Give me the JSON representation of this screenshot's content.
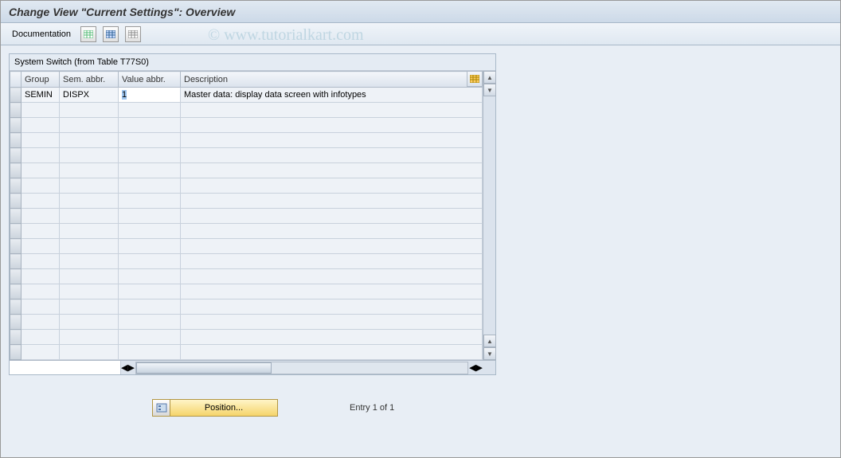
{
  "header": {
    "title": "Change View \"Current Settings\": Overview"
  },
  "toolbar": {
    "documentation_label": "Documentation"
  },
  "watermark": "© www.tutorialkart.com",
  "grid": {
    "caption": "System Switch (from Table T77S0)",
    "columns": {
      "group": "Group",
      "sem": "Sem. abbr.",
      "value": "Value abbr.",
      "desc": "Description"
    },
    "rows": [
      {
        "group": "SEMIN",
        "sem": "DISPX",
        "value": "1",
        "desc": "Master data: display data screen with infotypes"
      }
    ],
    "empty_row_count": 17
  },
  "footer": {
    "position_label": "Position...",
    "entry_text": "Entry 1 of 1"
  }
}
